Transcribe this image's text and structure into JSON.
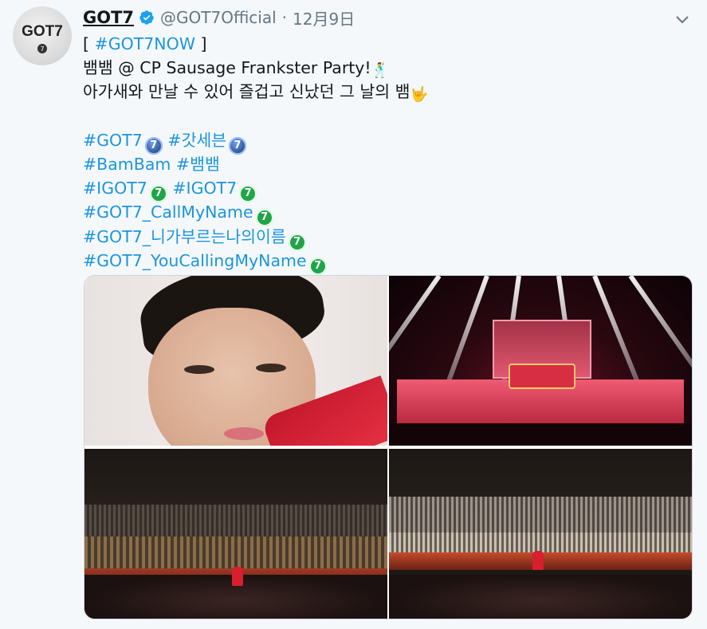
{
  "tweet": {
    "avatar_text": "GOT7",
    "avatar_badge": "7",
    "name": "GOT7",
    "handle": "@GOT7Official",
    "separator": "·",
    "date": "12月9日",
    "lines": {
      "l1_open": "[ ",
      "l1_tag": "#GOT7NOW",
      "l1_close": " ]",
      "l2_text": "뱀뱀 @ CP Sausage Frankster Party!",
      "l2_emoji": "🕺",
      "l3_text": "아가새와 만날 수 있어 즐겁고 신났던 그 날의 뱀",
      "l3_emoji": "🤟",
      "h1a": "#GOT7",
      "h1b": "#갓세븐",
      "h2a": "#BamBam",
      "h2b": "#뱀뱀",
      "h3a": "#IGOT7",
      "h3b": "#IGOT7",
      "h4": "#GOT7_CallMyName",
      "h5": "#GOT7_니가부르는나의이름",
      "h6": "#GOT7_YouCallingMyName"
    },
    "got7_emoji_glyph": "7"
  },
  "icons": {
    "verified": "verified-badge-icon",
    "more": "chevron-down-icon"
  },
  "colors": {
    "link": "#1b95e0",
    "secondary": "#657786",
    "verified": "#1da1f2",
    "background": "#f5f8fa"
  }
}
